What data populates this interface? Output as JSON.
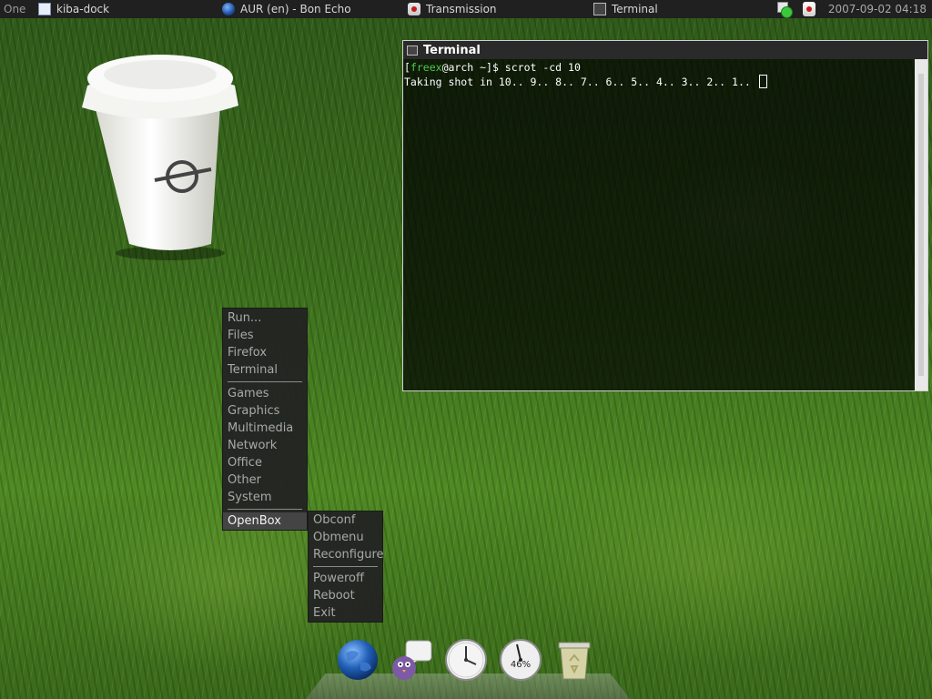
{
  "panel": {
    "workspace": "One",
    "tasks": [
      {
        "label": "kiba-dock",
        "icon": "document-icon"
      },
      {
        "label": "AUR (en) - Bon Echo",
        "icon": "browser-globe-icon"
      },
      {
        "label": "Transmission",
        "icon": "transmission-icon"
      },
      {
        "label": "Terminal",
        "icon": "terminal-icon"
      }
    ],
    "tray": [
      "status-icon",
      "transmission-tray-icon"
    ],
    "clock": "2007-09-02 04:18"
  },
  "terminal": {
    "title": "Terminal",
    "prompt_open": "[",
    "user": "freex",
    "prompt_rest": "@arch ~]$ scrot -cd 10",
    "output": "Taking shot in 10.. 9.. 8.. 7.. 6.. 5.. 4.. 3.. 2.. 1.. "
  },
  "root_menu": {
    "items": [
      "Run...",
      "Files",
      "Firefox",
      "Terminal"
    ],
    "categories": [
      "Games",
      "Graphics",
      "Multimedia",
      "Network",
      "Office",
      "Other",
      "System"
    ],
    "openbox": "OpenBox"
  },
  "openbox_menu": {
    "items": [
      "Obconf",
      "Obmenu",
      "Reconfigure"
    ],
    "session": [
      "Poweroff",
      "Reboot",
      "Exit"
    ]
  },
  "dock": {
    "gauge_label": "46%",
    "items": [
      "browser-globe-icon",
      "instant-messenger-icon",
      "clock-icon",
      "cpu-gauge-icon",
      "trash-icon"
    ]
  },
  "colors": {
    "panel_bg": "#202020",
    "terminal_user": "#4ec94e",
    "menu_bg": "#222222",
    "menu_text": "#a9a9a9"
  }
}
